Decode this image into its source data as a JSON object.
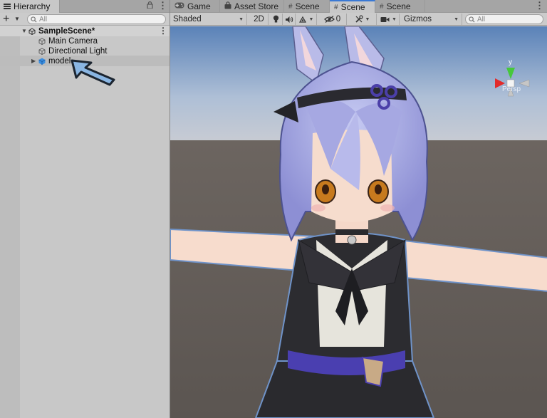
{
  "hierarchy": {
    "tab_label": "Hierarchy",
    "search_placeholder": "All",
    "items": [
      {
        "label": "SampleScene*"
      },
      {
        "label": "Main Camera"
      },
      {
        "label": "Directional Light"
      },
      {
        "label": "model"
      }
    ]
  },
  "tabs": [
    {
      "label": "Game"
    },
    {
      "label": "Asset Store"
    },
    {
      "label": "Scene"
    },
    {
      "label": "Scene"
    },
    {
      "label": "Scene"
    }
  ],
  "scene_toolbar": {
    "shading_mode": "Shaded",
    "two_d_label": "2D",
    "hidden_count": "0",
    "gizmos_label": "Gizmos",
    "search_placeholder": "All"
  },
  "orientation_gizmo": {
    "axis_label": "y",
    "projection_label": "Persp"
  },
  "colors": {
    "active_tab_accent": "#3a79d4",
    "gizmo_y": "#46c83a",
    "gizmo_x": "#e22b2b",
    "arrow_fill": "#8ab6e3"
  }
}
